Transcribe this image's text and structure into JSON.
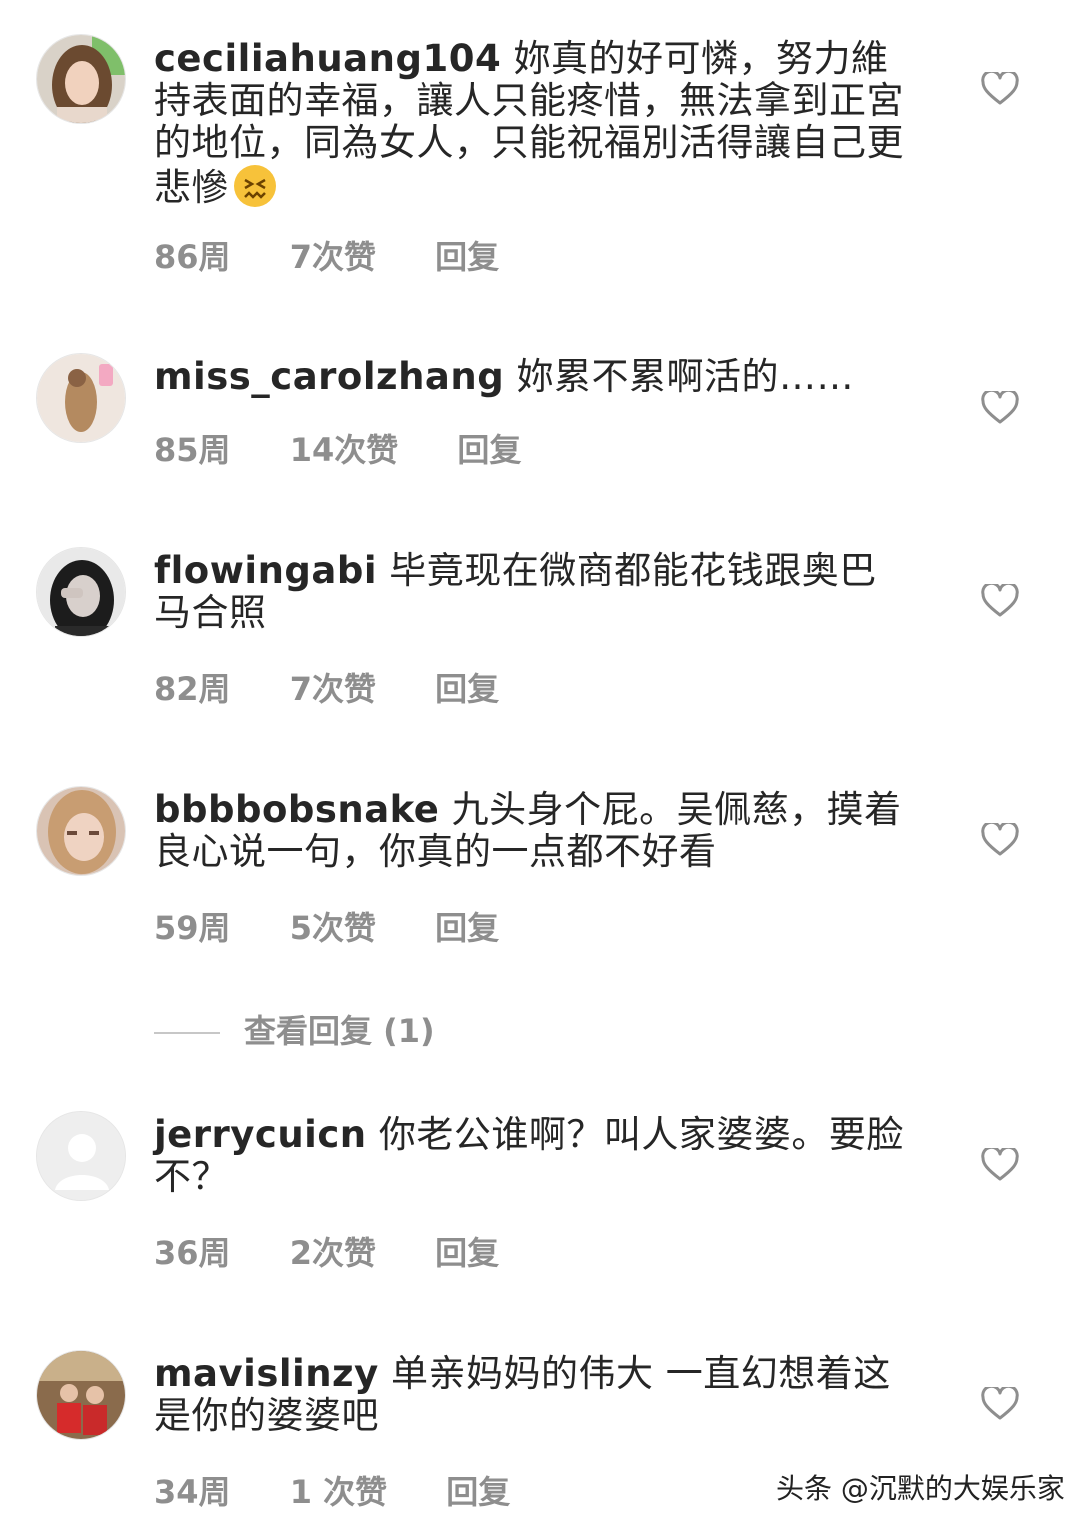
{
  "comments": [
    {
      "username": "ceciliahuang104",
      "text": " 妳真的好可憐，努力維持表面的幸福，讓人只能疼惜，無法拿到正宮的地位，同為女人，只能祝福別活得讓自己更悲慘",
      "time": "86周",
      "likes": "7次赞",
      "reply": "回复"
    },
    {
      "username": "miss_carolzhang",
      "text": " 妳累不累啊活的……",
      "time": "85周",
      "likes": "14次赞",
      "reply": "回复"
    },
    {
      "username": "flowingabi",
      "text": " 毕竟现在微商都能花钱跟奥巴马合照",
      "time": "82周",
      "likes": "7次赞",
      "reply": "回复"
    },
    {
      "username": "bbbbobsnake",
      "text": " 九头身个屁。吴佩慈，摸着良心说一句，你真的一点都不好看",
      "time": "59周",
      "likes": "5次赞",
      "reply": "回复"
    },
    {
      "username": "jerrycuicn",
      "text": " 你老公谁啊？叫人家婆婆。要脸不？",
      "time": "36周",
      "likes": "2次赞",
      "reply": "回复"
    },
    {
      "username": "mavislinzy",
      "text": " 单亲妈妈的伟大 一直幻想着这是你的婆婆吧",
      "time": "34周",
      "likes": "1 次赞",
      "reply": "回复"
    }
  ],
  "view_replies": "查看回复 (1)",
  "watermark": "头条 @沉默的大娱乐家",
  "icons": {
    "like": "heart-outline-icon",
    "emoji": "confounded-face-emoji"
  }
}
